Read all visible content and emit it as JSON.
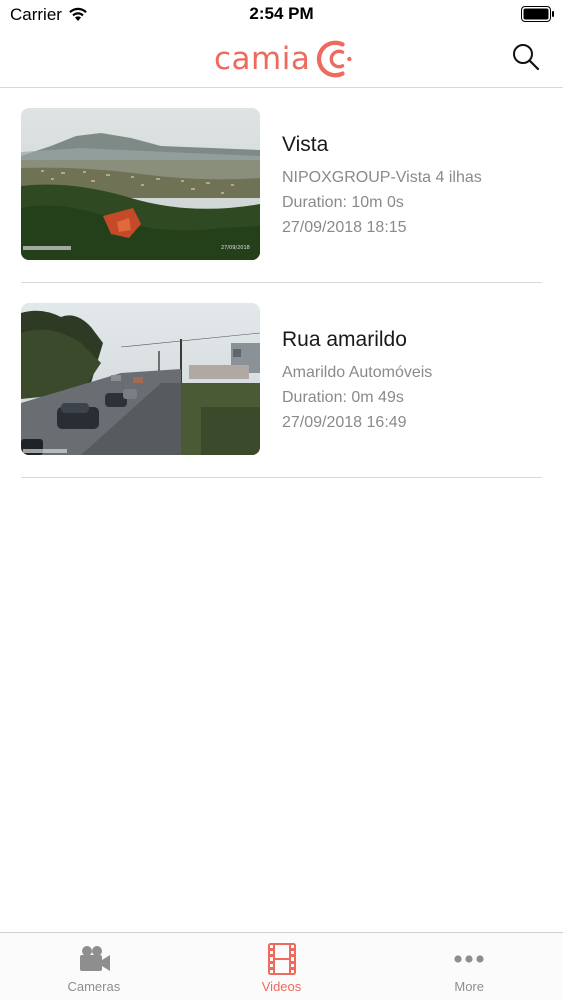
{
  "status_bar": {
    "carrier": "Carrier",
    "time": "2:54 PM"
  },
  "header": {
    "logo_text": "camia",
    "brand_color": "#ee6a5e",
    "search_icon": "search-icon"
  },
  "videos": [
    {
      "title": "Vista",
      "camera": "NIPOXGROUP-Vista 4 ilhas",
      "duration": "Duration: 10m 0s",
      "date": "27/09/2018 18:15",
      "thumb_caption": "27/09/2018"
    },
    {
      "title": "Rua amarildo",
      "camera": "Amarildo Automóveis",
      "duration": "Duration: 0m 49s",
      "date": "27/09/2018 16:49"
    }
  ],
  "tab_bar": {
    "tabs": [
      {
        "label": "Cameras",
        "icon": "video-camera-icon",
        "active": false
      },
      {
        "label": "Videos",
        "icon": "film-icon",
        "active": true
      },
      {
        "label": "More",
        "icon": "more-icon",
        "active": false
      }
    ],
    "active_color": "#ee6a5e",
    "inactive_color": "#8e8e8e"
  }
}
